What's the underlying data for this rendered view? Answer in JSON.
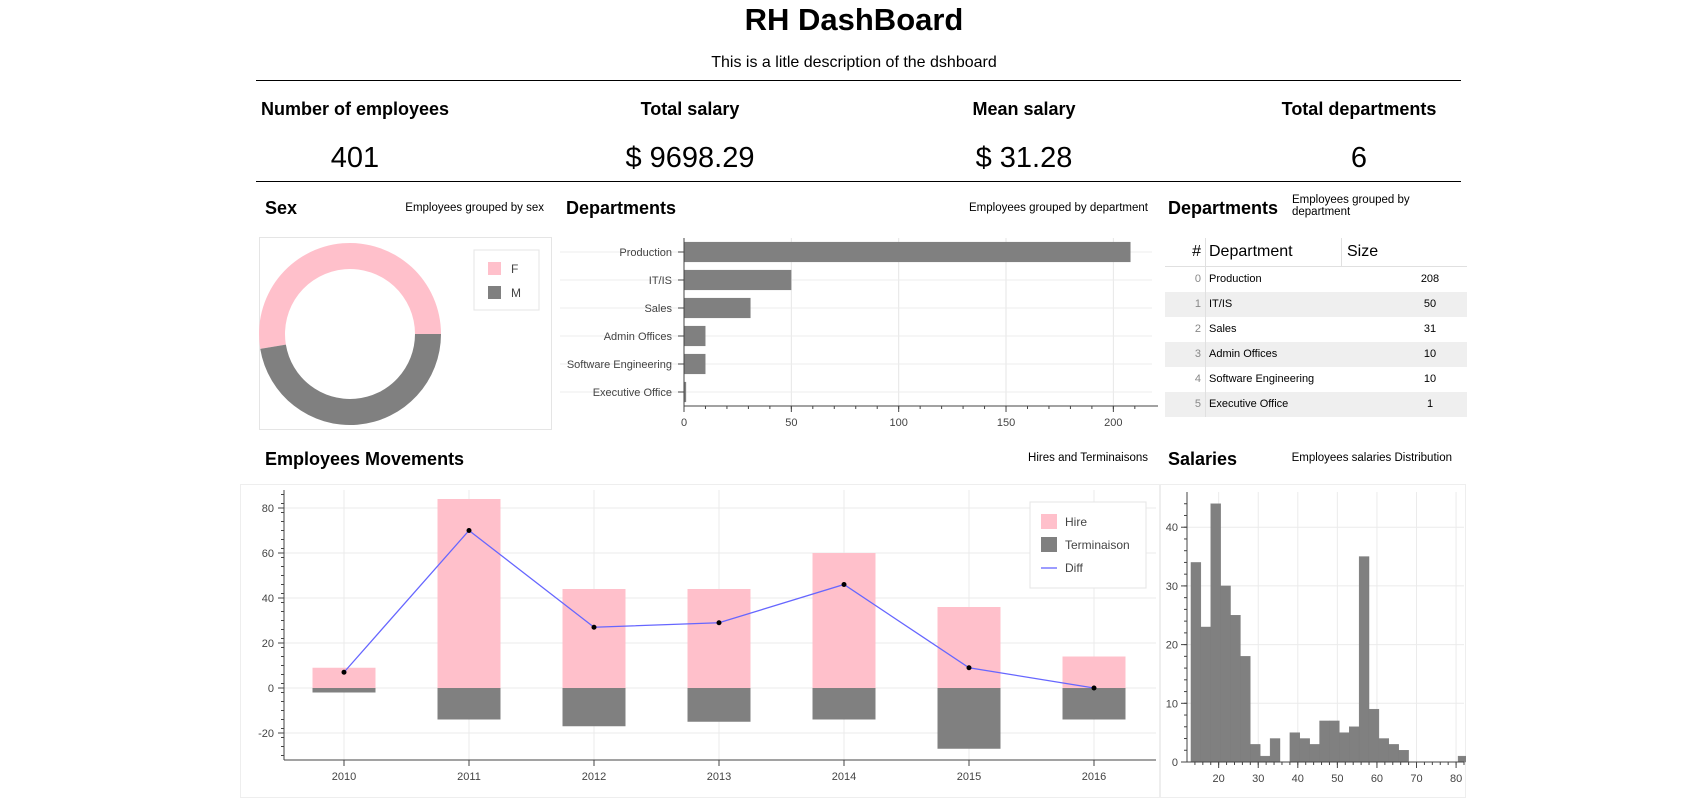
{
  "header": {
    "title": "RH DashBoard",
    "description": "This is a litle description of the dshboard"
  },
  "kpis": [
    {
      "label": "Number of employees",
      "value": "401"
    },
    {
      "label": "Total salary",
      "value": "$ 9698.29"
    },
    {
      "label": "Mean salary",
      "value": "$ 31.28"
    },
    {
      "label": "Total departments",
      "value": "6"
    }
  ],
  "sections": {
    "sex": {
      "title": "Sex",
      "subtitle": "Employees grouped by sex"
    },
    "departments_chart": {
      "title": "Departments",
      "subtitle": "Employees grouped by department"
    },
    "departments_table": {
      "title": "Departments",
      "subtitle": "Employees grouped by department"
    },
    "movements": {
      "title": "Employees Movements",
      "subtitle": "Hires and Terminaisons"
    },
    "salaries": {
      "title": "Salaries",
      "subtitle": "Employees salaries Distribution"
    }
  },
  "colors": {
    "pink": "#ffc0cb",
    "gray": "#808080",
    "line": "#6666ff"
  },
  "table": {
    "headers": [
      "#",
      "Department",
      "Size"
    ],
    "rows": [
      [
        "0",
        "Production",
        "208"
      ],
      [
        "1",
        "IT/IS",
        "50"
      ],
      [
        "2",
        "Sales",
        "31"
      ],
      [
        "3",
        "Admin Offices",
        "10"
      ],
      [
        "4",
        "Software Engineering",
        "10"
      ],
      [
        "5",
        "Executive Office",
        "1"
      ]
    ]
  },
  "chart_data": [
    {
      "type": "pie",
      "categories": [
        "F",
        "M"
      ],
      "values": [
        211,
        190
      ],
      "legend": "top-right"
    },
    {
      "type": "bar",
      "orientation": "horizontal",
      "categories": [
        "Production",
        "IT/IS",
        "Sales",
        "Admin Offices",
        "Software Engineering",
        "Executive Office"
      ],
      "values": [
        208,
        50,
        31,
        10,
        10,
        1
      ],
      "xticks": [
        0,
        50,
        100,
        150,
        200
      ],
      "xlim": [
        0,
        218
      ],
      "grid": true
    },
    {
      "type": "bar",
      "categories": [
        "2010",
        "2011",
        "2012",
        "2013",
        "2014",
        "2015",
        "2016"
      ],
      "series": [
        {
          "name": "Hire",
          "values": [
            9,
            84,
            44,
            44,
            60,
            36,
            14
          ]
        },
        {
          "name": "Terminaison",
          "values": [
            -2,
            -14,
            -17,
            -15,
            -14,
            -27,
            -14
          ]
        },
        {
          "name": "Diff",
          "type": "line",
          "values": [
            7,
            70,
            27,
            29,
            46,
            9,
            0
          ]
        }
      ],
      "yticks": [
        -20,
        0,
        20,
        40,
        60,
        80
      ],
      "ylim": [
        -32,
        88
      ],
      "legend": "top-right",
      "grid": true
    },
    {
      "type": "bar",
      "histogram": true,
      "bin_start": 13,
      "bin_width": 2.5,
      "values": [
        34,
        23,
        44,
        30,
        25,
        18,
        3,
        1,
        4,
        0,
        5,
        4,
        3,
        7,
        7,
        5,
        6,
        35,
        9,
        4,
        3,
        2,
        0,
        0,
        0,
        0,
        0,
        1
      ],
      "xticks": [
        20,
        30,
        40,
        50,
        60,
        70,
        80
      ],
      "yticks": [
        0,
        10,
        20,
        30,
        40
      ],
      "xlim": [
        12,
        82
      ],
      "ylim": [
        0,
        46
      ],
      "grid": true
    }
  ]
}
